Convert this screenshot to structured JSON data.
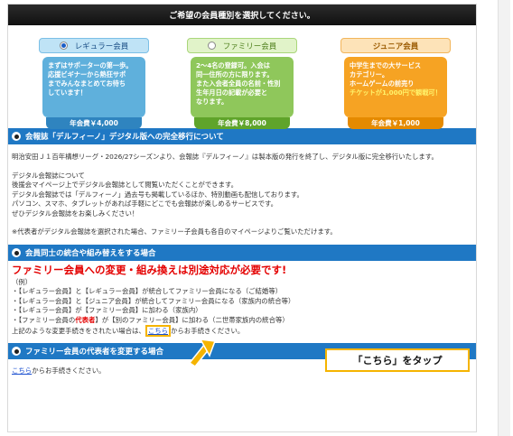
{
  "header": {
    "title": "ご希望の会員種別を選択してください。"
  },
  "plans": [
    {
      "label": "レギュラー会員",
      "selected": true,
      "description_lines": [
        "まずはサポーターの第一歩。",
        "応援ビギナーから熱狂サポ",
        "までみんなまとめてお待ち",
        "しています！"
      ],
      "price": "年会費￥4,000"
    },
    {
      "label": "ファミリー会員",
      "selected": false,
      "description_lines": [
        "2〜4名の登録可。入会は",
        "同一住所の方に限ります。",
        "また入会者全員の名前・性別",
        "生年月日の記載が必要と",
        "なります。"
      ],
      "price": "年会費￥8,000"
    },
    {
      "label": "ジュニア会員",
      "selected": false,
      "description_lines": [
        "中学生までの大サービス",
        "カテゴリー。",
        "ホームゲームの前売り",
        "チケットが1,000円で観戦可！"
      ],
      "price": "年会費￥1,000"
    }
  ],
  "section1": {
    "title": "会報誌「デルフィーノ」デジタル版への完全移行について",
    "p1": "明治安田Ｊ１百年構想リーグ・2026/27シーズンより、会報誌『デルフィーノ』は製本版の発行を終了し、デジタル版に完全移行いたします。",
    "p2": [
      "デジタル会報誌について",
      "後援会マイページ上でデジタル会報誌として閲覧いただくことができます。",
      "デジタル会報誌では「デルフィーノ」過去号も掲載しているほか、特別動画も配信しております。",
      "パソコン、スマホ、タブレットがあれば手軽にどこでも会報誌が楽しめるサービスです。",
      "ぜひデジタル会報誌をお楽しみください！"
    ],
    "p3": "※代表者がデジタル会報誌を選択された場合、ファミリー子会員も各自のマイページよりご覧いただけます。"
  },
  "section2": {
    "title": "会員同士の統合や組み替えをする場合",
    "headline": "ファミリー会員への変更・組み換えは別途対応が必要です!",
    "example": "（例）",
    "items": [
      "・【レギュラー会員】と【レギュラー会員】が統合してファミリー会員になる（ご結婚等）",
      "・【レギュラー会員】と【ジュニア会員】が統合してファミリー会員になる（家族内の統合等）",
      "・【レギュラー会員】が【ファミリー会員】に加わる（家族内）"
    ],
    "item4_pre": "・【ファミリー会員の",
    "item4_red": "代表者",
    "item4_post": "】が【別のファミリー会員】に加わる（二世帯家族内の統合等）",
    "closing_pre": "上記のような変更手続きをされたい場合は、",
    "closing_link": "こちら",
    "closing_post": "からお手続きください。"
  },
  "section3": {
    "title": "ファミリー会員の代表者を変更する場合",
    "link": "こちら",
    "text_post": "からお手続きください。"
  },
  "callout": {
    "text": "「こちら」をタップ"
  },
  "colors": {
    "section_blue": "#1f78c4",
    "highlight_yellow": "#f5b400",
    "alert_red": "#e40000"
  }
}
